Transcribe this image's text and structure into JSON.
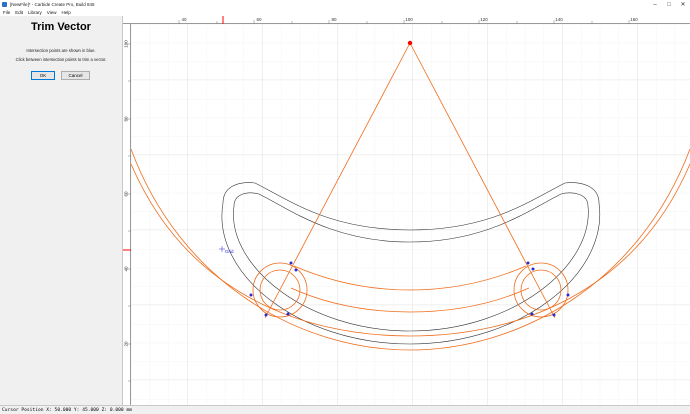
{
  "window": {
    "title": "[NewFile]* - Carbide Create Pro, Build 845",
    "controls": [
      "–",
      "□",
      "✕"
    ]
  },
  "menu": [
    "File",
    "Edit",
    "Library",
    "View",
    "Help"
  ],
  "panel": {
    "title": "Trim Vector",
    "line1": "Intersection points are shown in blue.",
    "line2": "Click between intersection points to trim a vector.",
    "ok_label": "OK",
    "cancel_label": "Cancel"
  },
  "rulers": {
    "top_ticks": [
      "40",
      "60",
      "80",
      "100",
      "120",
      "140",
      "160"
    ],
    "left_ticks": [
      "100",
      "80",
      "60",
      "40",
      "20"
    ]
  },
  "canvas": {
    "grid_label": "Grid"
  },
  "status": {
    "cursor": "Cursor Position X: 50.000 Y: 45.000 Z: 0.000 mm"
  },
  "colors": {
    "vector_selected": "#ef6c1a",
    "vector_normal": "#333333",
    "intersection": "#2b2bd6",
    "marker": "#ff0000",
    "grid_minor": "#ececec",
    "grid_major": "#d6d6d6"
  }
}
